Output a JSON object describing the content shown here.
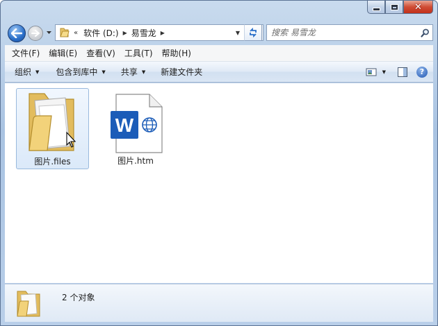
{
  "window": {
    "caption_buttons": [
      "minimize",
      "maximize",
      "close"
    ],
    "close_glyph": "✕"
  },
  "nav": {
    "breadcrumb_overflow": "«",
    "breadcrumbs": [
      "软件 (D:)",
      "易雪龙"
    ],
    "search_placeholder": "搜索 易雪龙"
  },
  "menu": {
    "items": [
      "文件(F)",
      "编辑(E)",
      "查看(V)",
      "工具(T)",
      "帮助(H)"
    ]
  },
  "toolbar": {
    "organize": "组织",
    "include_in_library": "包含到库中",
    "share": "共享",
    "new_folder": "新建文件夹",
    "help_glyph": "?"
  },
  "files": [
    {
      "name": "图片.files",
      "type": "folder",
      "selected": true
    },
    {
      "name": "图片.htm",
      "type": "word-html-document",
      "selected": false
    }
  ],
  "details": {
    "count_text": "2 个对象"
  },
  "colors": {
    "accent_blue": "#2a6fc9",
    "word_blue": "#1b5cb8",
    "folder_yellow": "#e8c56a",
    "close_red": "#c2301a"
  }
}
